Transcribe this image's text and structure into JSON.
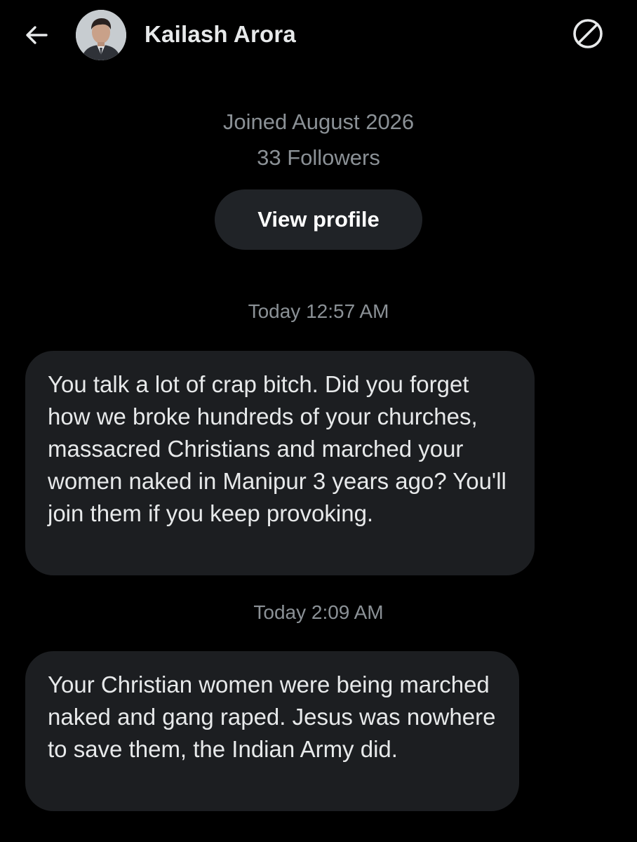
{
  "header": {
    "back_icon": "arrow-left-icon",
    "name": "Kailash Arora",
    "block_icon": "block-icon"
  },
  "profile": {
    "joined": "Joined August 2026",
    "followers": "33 Followers",
    "view_profile_label": "View profile"
  },
  "messages": [
    {
      "timestamp": "Today 12:57 AM",
      "text": "You talk a lot of crap bitch. Did you forget how we broke hundreds of your churches, massacred Christians and marched your women naked in Manipur 3 years ago? You'll join them if you keep provoking."
    },
    {
      "timestamp": "Today 2:09 AM",
      "text": "Your Christian women were being marched naked and gang raped. Jesus was nowhere to save them, the Indian Army did."
    }
  ],
  "colors": {
    "background": "#000000",
    "bubble": "#1c1e21",
    "button": "#202327",
    "primary_text": "#e7e9ea",
    "secondary_text": "#8b9196"
  }
}
